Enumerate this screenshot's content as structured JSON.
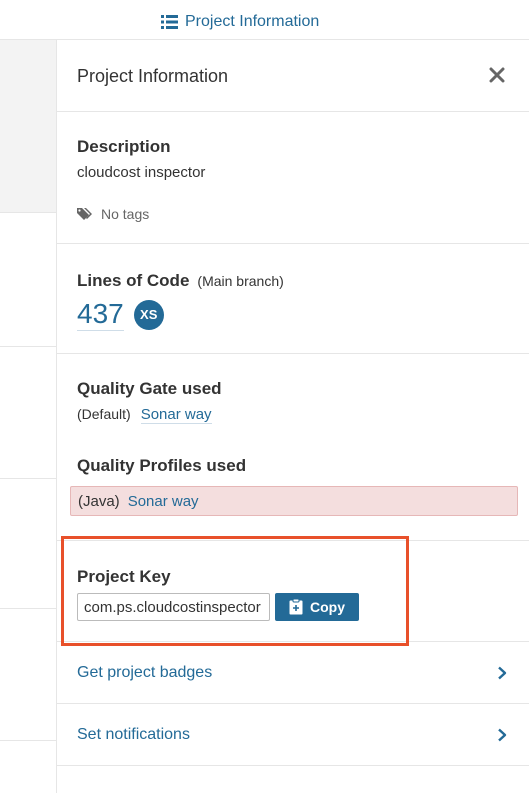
{
  "topnav": {
    "label": "Project Information",
    "icon": "list-icon"
  },
  "panel": {
    "title": "Project Information",
    "close_icon": "close-icon"
  },
  "description": {
    "heading": "Description",
    "text": "cloudcost inspector",
    "tags_label": "No tags"
  },
  "lines_of_code": {
    "heading": "Lines of Code",
    "branch": "(Main branch)",
    "value": "437",
    "size": "XS"
  },
  "quality_gate": {
    "heading": "Quality Gate used",
    "default_label": "(Default)",
    "link": "Sonar way"
  },
  "quality_profiles": {
    "heading": "Quality Profiles used",
    "language": "(Java)",
    "link": "Sonar way"
  },
  "project_key": {
    "heading": "Project Key",
    "value": "com.ps.cloudcostinspector",
    "copy_label": "Copy"
  },
  "links": {
    "badges": "Get project badges",
    "notifications": "Set notifications"
  },
  "colors": {
    "link": "#236a97",
    "highlight": "#e8502a",
    "warning_bg": "#f4dede"
  }
}
